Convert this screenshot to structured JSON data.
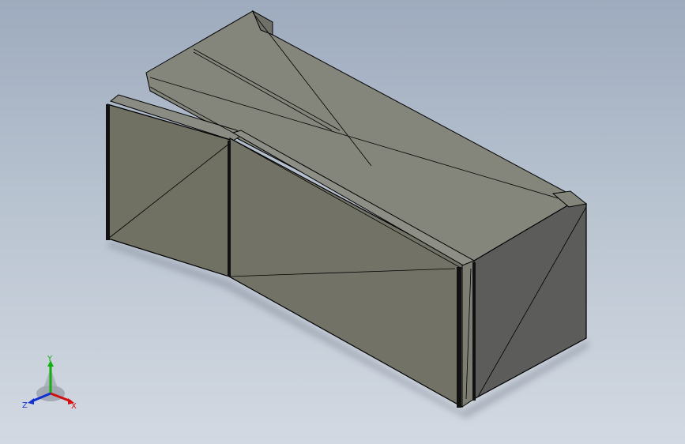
{
  "viewport": {
    "background_top": "#9eabbe",
    "background_bottom": "#d3d9e2",
    "part_face_color": "#6f6f63",
    "part_top_color": "#83857c",
    "part_side_color": "#5a5a58",
    "edge_color": "#000000"
  },
  "triad": {
    "x_label": "X",
    "y_label": "Y",
    "z_label": "Z",
    "x_color": "#d01010",
    "y_color": "#10b010",
    "z_color": "#1030d0"
  }
}
